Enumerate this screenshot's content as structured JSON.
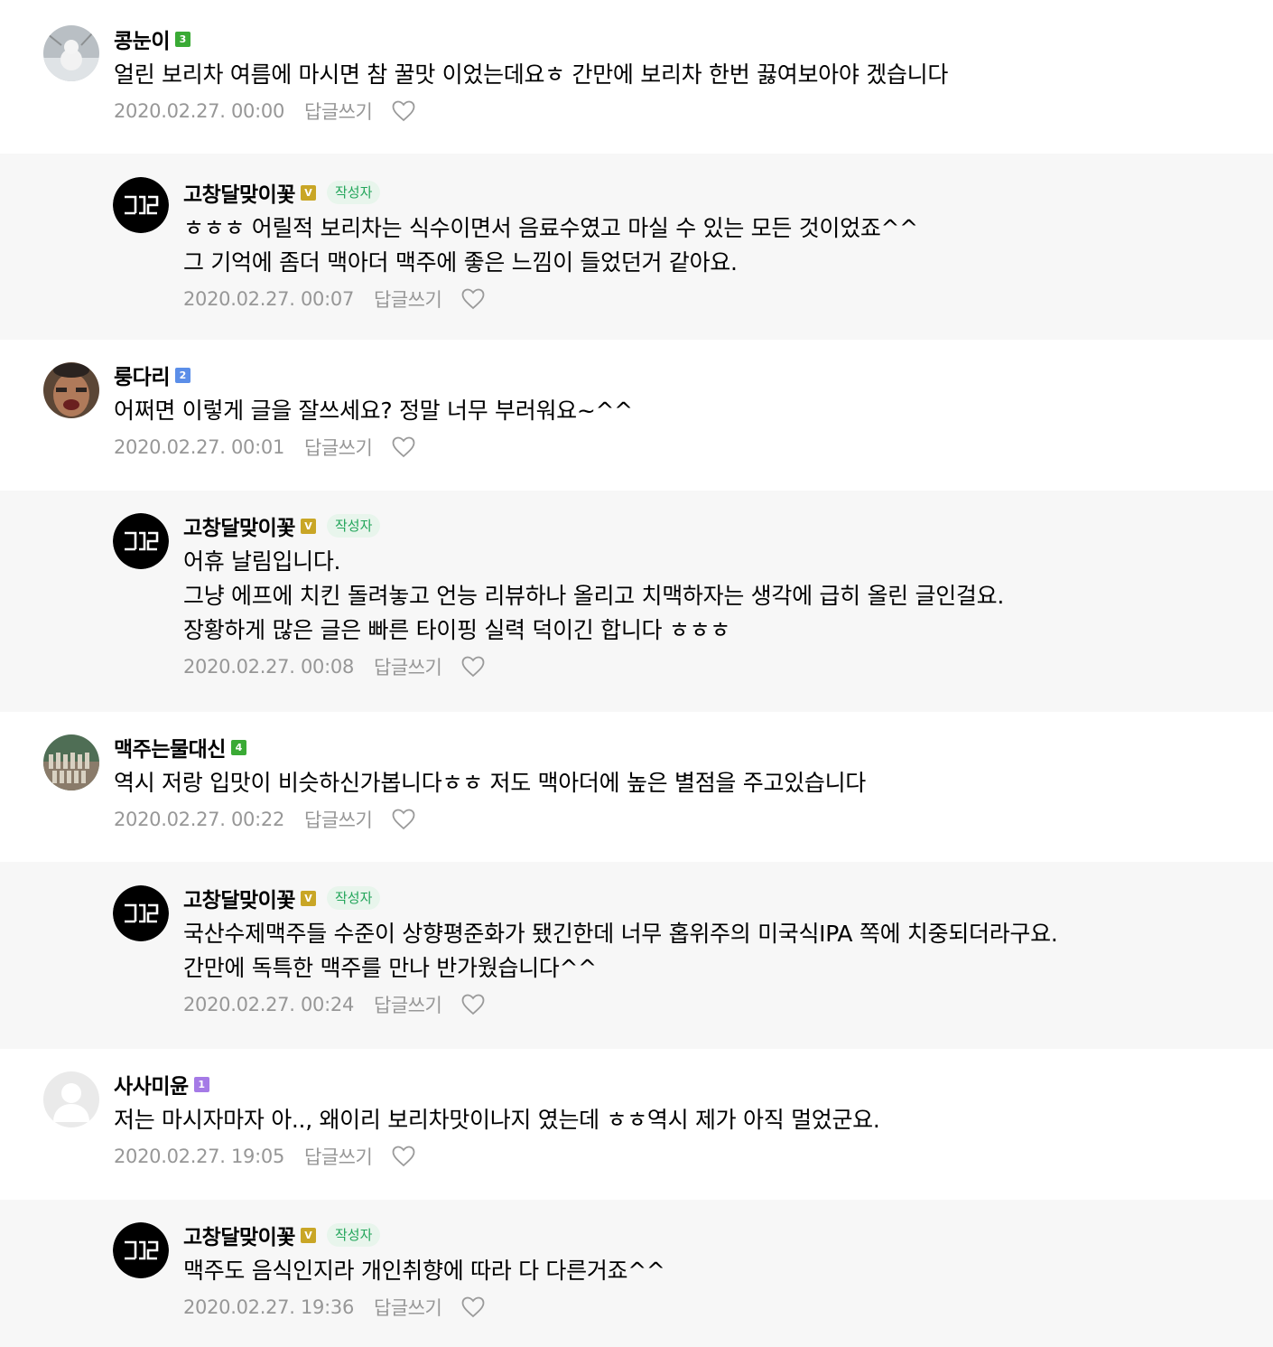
{
  "comments": [
    {
      "nick": "콩눈이",
      "level": "3",
      "level_color": "#3aaa35",
      "avatar": "snowman-avatar",
      "lines": [
        "얼린 보리차 여름에 마시면 참 꿀맛 이었는데요ㅎ 간만에 보리차 한번 끓여보아야 겠습니다"
      ],
      "date": "2020.02.27. 00:00",
      "reply_label": "답글쓰기"
    },
    {
      "nick": "고창달맞이꽃",
      "level": "V",
      "level_color": "#c9a626",
      "author_tag": "작성자",
      "avatar": "gd-logo-avatar",
      "lines": [
        "ㅎㅎㅎ 어릴적 보리차는 식수이면서 음료수였고 마실 수 있는 모든 것이었죠^^",
        "그 기억에 좀더 맥아더 맥주에 좋은 느낌이 들었던거 같아요."
      ],
      "date": "2020.02.27. 00:07",
      "reply_label": "답글쓰기"
    },
    {
      "nick": "룽다리",
      "level": "2",
      "level_color": "#5b8ee8",
      "avatar": "face-avatar",
      "lines": [
        "어쩌면 이렇게 글을 잘쓰세요? 정말 너무 부러워요~^^"
      ],
      "date": "2020.02.27. 00:01",
      "reply_label": "답글쓰기"
    },
    {
      "nick": "고창달맞이꽃",
      "level": "V",
      "level_color": "#c9a626",
      "author_tag": "작성자",
      "avatar": "gd-logo-avatar",
      "lines": [
        "어휴 날림입니다.",
        "그냥 에프에 치킨 돌려놓고 언능 리뷰하나 올리고 치맥하자는 생각에 급히 올린 글인걸요.",
        "장황하게 많은 글은 빠른 타이핑 실력 덕이긴 합니다 ㅎㅎㅎ"
      ],
      "date": "2020.02.27. 00:08",
      "reply_label": "답글쓰기"
    },
    {
      "nick": "맥주는물대신",
      "level": "4",
      "level_color": "#3aaa35",
      "avatar": "bottles-avatar",
      "lines": [
        "역시 저랑 입맛이 비슷하신가봅니다ㅎㅎ 저도 맥아더에 높은 별점을 주고있습니다"
      ],
      "date": "2020.02.27. 00:22",
      "reply_label": "답글쓰기"
    },
    {
      "nick": "고창달맞이꽃",
      "level": "V",
      "level_color": "#c9a626",
      "author_tag": "작성자",
      "avatar": "gd-logo-avatar",
      "lines": [
        "국산수제맥주들 수준이 상향평준화가 됐긴한데 너무 홉위주의 미국식IPA 쪽에 치중되더라구요.",
        "간만에 독특한 맥주를 만나 반가웠습니다^^"
      ],
      "date": "2020.02.27. 00:24",
      "reply_label": "답글쓰기"
    },
    {
      "nick": "사사미윤",
      "level": "1",
      "level_color": "#a57ae6",
      "avatar": "default-user-avatar",
      "lines": [
        "저는 마시자마자 아.., 왜이리 보리차맛이나지 였는데 ㅎㅎ역시 제가 아직 멀었군요."
      ],
      "date": "2020.02.27. 19:05",
      "reply_label": "답글쓰기"
    },
    {
      "nick": "고창달맞이꽃",
      "level": "V",
      "level_color": "#c9a626",
      "author_tag": "작성자",
      "avatar": "gd-logo-avatar",
      "lines": [
        "맥주도 음식인지라 개인취향에 따라 다 다른거죠^^"
      ],
      "date": "2020.02.27. 19:36",
      "reply_label": "답글쓰기"
    }
  ]
}
